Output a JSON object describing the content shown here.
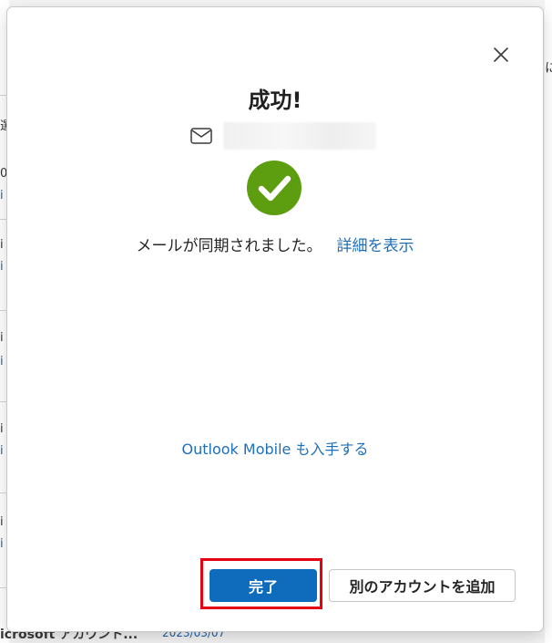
{
  "dialog": {
    "title": "成功!",
    "sync_message": "メールが同期されました。",
    "details_link": "詳細を表示",
    "outlook_mobile_link": "Outlook Mobile も入手する",
    "done_button": "完了",
    "add_account_button": "別のアカウントを追加"
  },
  "background": {
    "list_sender": "icrosoft アカウント...",
    "list_date": "2023/03/07",
    "right_char": "に"
  },
  "colors": {
    "primary": "#0f6cbd",
    "link": "#1f6eb8",
    "success": "#5c9e0f",
    "highlight": "#e60012"
  },
  "icons": [
    "close-icon",
    "mail-icon",
    "checkmark-circle-icon"
  ]
}
